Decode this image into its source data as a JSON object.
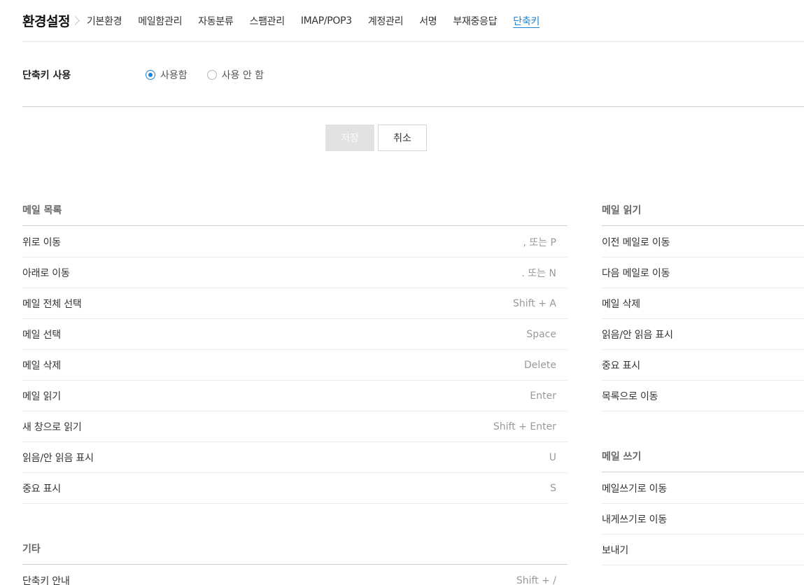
{
  "header": {
    "title": "환경설정",
    "tabs": [
      {
        "label": "기본환경"
      },
      {
        "label": "메일함관리"
      },
      {
        "label": "자동분류"
      },
      {
        "label": "스팸관리"
      },
      {
        "label": "IMAP/POP3"
      },
      {
        "label": "계정관리"
      },
      {
        "label": "서명"
      },
      {
        "label": "부재중응답"
      },
      {
        "label": "단축키",
        "active": true
      }
    ]
  },
  "setting": {
    "label": "단축키 사용",
    "options": [
      {
        "label": "사용함",
        "checked": true
      },
      {
        "label": "사용 안 함",
        "checked": false
      }
    ]
  },
  "buttons": {
    "save": "저장",
    "cancel": "취소"
  },
  "mail_list": {
    "title": "메일 목록",
    "items": [
      {
        "name": "위로 이동",
        "key": ", 또는 P"
      },
      {
        "name": "아래로 이동",
        "key": ". 또는 N"
      },
      {
        "name": "메일 전체 선택",
        "key": "Shift + A"
      },
      {
        "name": "메일 선택",
        "key": "Space"
      },
      {
        "name": "메일 삭제",
        "key": "Delete"
      },
      {
        "name": "메일 읽기",
        "key": "Enter"
      },
      {
        "name": "새 창으로 읽기",
        "key": "Shift + Enter"
      },
      {
        "name": "읽음/안 읽음 표시",
        "key": "U"
      },
      {
        "name": "중요 표시",
        "key": "S"
      }
    ]
  },
  "etc": {
    "title": "기타",
    "items": [
      {
        "name": "단축키 안내",
        "key": "Shift + /"
      }
    ]
  },
  "mail_read": {
    "title": "메일 읽기",
    "items": [
      {
        "name": "이전 메일로 이동"
      },
      {
        "name": "다음 메일로 이동"
      },
      {
        "name": "메일 삭제"
      },
      {
        "name": "읽음/안 읽음 표시"
      },
      {
        "name": "중요 표시"
      },
      {
        "name": "목록으로 이동"
      }
    ]
  },
  "mail_write": {
    "title": "메일 쓰기",
    "items": [
      {
        "name": "메일쓰기로 이동"
      },
      {
        "name": "내게쓰기로 이동"
      },
      {
        "name": "보내기"
      }
    ]
  },
  "colors": {
    "accent": "#1b82d1",
    "disabled_button": "#e2e2e2"
  }
}
